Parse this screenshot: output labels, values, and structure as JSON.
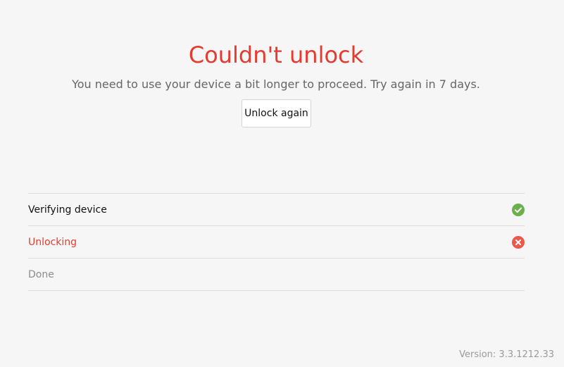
{
  "header": {
    "title": "Couldn't unlock",
    "message": "You need to use your device a bit longer to proceed. Try again in 7 days."
  },
  "actions": {
    "unlock_again_label": "Unlock again"
  },
  "steps": [
    {
      "label": "Verifying device",
      "status": "success",
      "icon": "check-circle-icon"
    },
    {
      "label": "Unlocking",
      "status": "failed",
      "icon": "error-circle-icon"
    },
    {
      "label": "Done",
      "status": "pending",
      "icon": ""
    }
  ],
  "footer": {
    "version": "Version: 3.3.1212.33"
  },
  "colors": {
    "error": "#e53a2f",
    "success": "#6ab04c",
    "error_icon": "#ea5a4a",
    "background": "#f6f6f6"
  }
}
